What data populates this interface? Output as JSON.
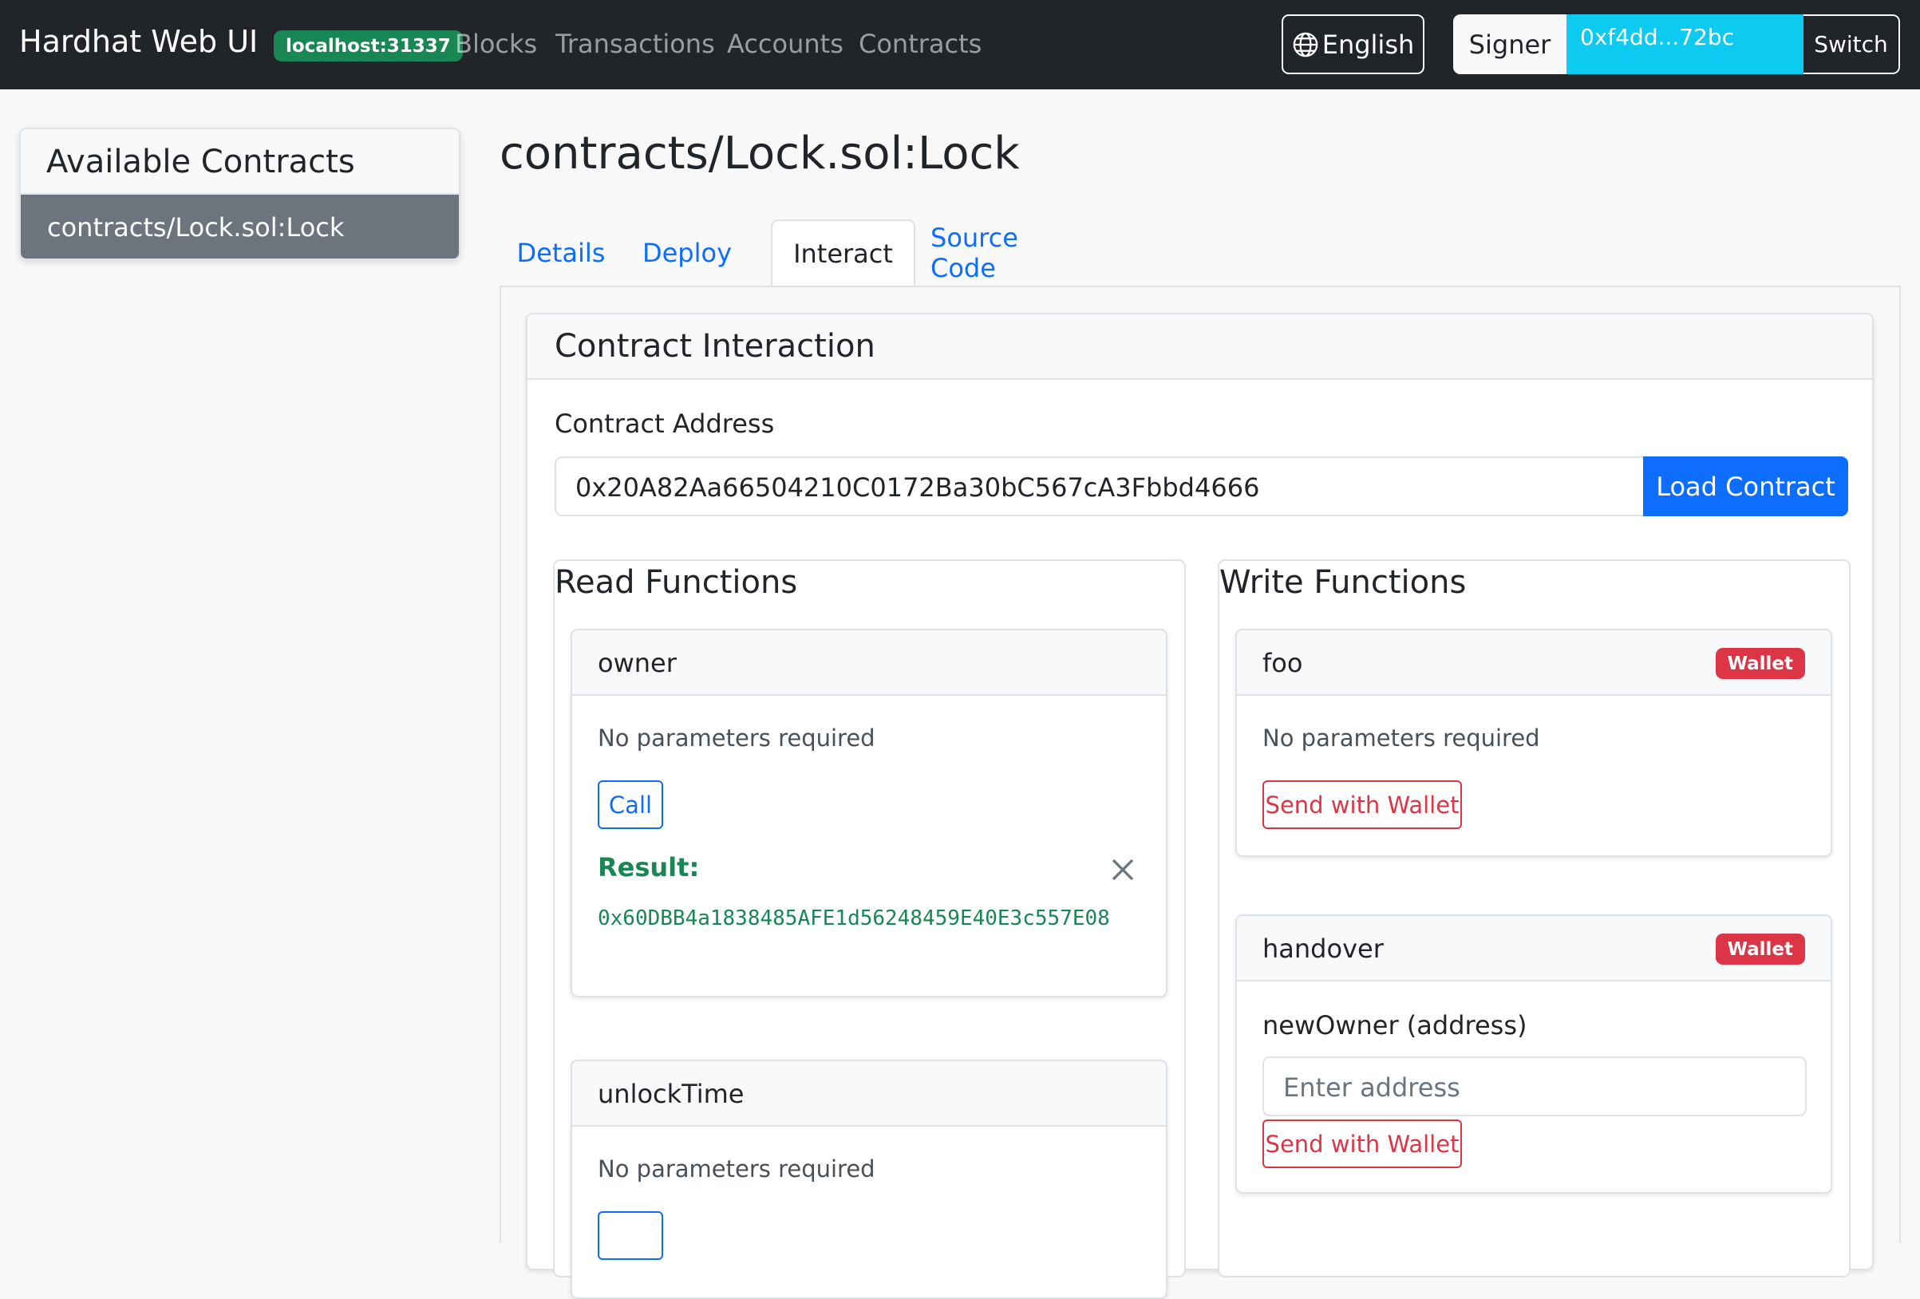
{
  "navbar": {
    "brand": "Hardhat Web UI",
    "network_badge": "localhost:31337",
    "links": [
      "Blocks",
      "Transactions",
      "Accounts",
      "Contracts"
    ],
    "language": "English",
    "signer_label": "Signer",
    "signer_address": "0xf4dd...72bc",
    "switch_label": "Switch"
  },
  "sidebar": {
    "title": "Available Contracts",
    "items": [
      "contracts/Lock.sol:Lock"
    ]
  },
  "main": {
    "title": "contracts/Lock.sol:Lock",
    "tabs": [
      "Details",
      "Deploy",
      "Interact",
      "Source Code"
    ],
    "active_tab": "Interact",
    "interaction": {
      "title": "Contract Interaction",
      "address_label": "Contract Address",
      "address_value": "0x20A82Aa66504210C0172Ba30bC567cA3Fbbd4666",
      "load_button": "Load Contract"
    },
    "read_functions": {
      "title": "Read Functions",
      "owner": {
        "name": "owner",
        "params_text": "No parameters required",
        "call_label": "Call",
        "result_label": "Result:",
        "result_value": "0x60DBB4a1838485AFE1d56248459E40E3c557E08"
      },
      "unlockTime": {
        "name": "unlockTime",
        "params_text": "No parameters required"
      }
    },
    "write_functions": {
      "title": "Write Functions",
      "foo": {
        "name": "foo",
        "badge": "Wallet",
        "params_text": "No parameters required",
        "send_label": "Send with Wallet"
      },
      "handover": {
        "name": "handover",
        "badge": "Wallet",
        "param_label": "newOwner (address)",
        "param_placeholder": "Enter address",
        "send_label": "Send with Wallet"
      }
    }
  },
  "colors": {
    "navbar_bg": "#212529",
    "primary": "#0d6efd",
    "success": "#198754",
    "danger": "#dc3545",
    "info": "#0dcaf0",
    "secondary": "#6c757d"
  }
}
